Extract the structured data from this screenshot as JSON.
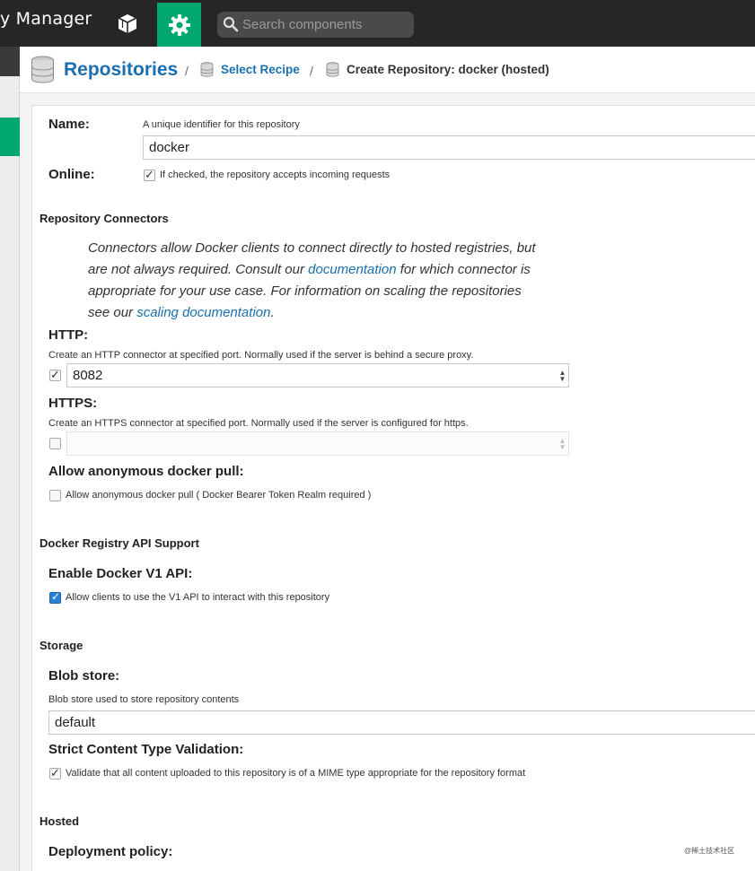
{
  "app": {
    "title": "y Manager"
  },
  "topbar": {
    "browse_icon": "cube-icon",
    "admin_icon": "gear-icon",
    "search": {
      "placeholder": "Search components",
      "value": ""
    }
  },
  "breadcrumb": {
    "root": "Repositories",
    "separator": "/",
    "recipe": "Select Recipe",
    "current": "Create Repository: docker (hosted)"
  },
  "form": {
    "name": {
      "label": "Name:",
      "help": "A unique identifier for this repository",
      "value": "docker"
    },
    "online": {
      "label": "Online:",
      "checkbox_label": "If checked, the repository accepts incoming requests",
      "checked": true
    },
    "connectors": {
      "section": "Repository Connectors",
      "info_1": "Connectors allow Docker clients to connect directly to hosted registries, but are not always required. Consult our ",
      "info_link_1": "documentation",
      "info_2": " for which connector is appropriate for your use case. For information on scaling the repositories see our ",
      "info_link_2": "scaling documentation",
      "info_3": ".",
      "http": {
        "label": "HTTP:",
        "help": "Create an HTTP connector at specified port. Normally used if the server is behind a secure proxy.",
        "checked": true,
        "value": "8082"
      },
      "https": {
        "label": "HTTPS:",
        "help": "Create an HTTPS connector at specified port. Normally used if the server is configured for https.",
        "checked": false,
        "value": ""
      },
      "anon": {
        "label": "Allow anonymous docker pull:",
        "checkbox_label": "Allow anonymous docker pull ( Docker Bearer Token Realm required )",
        "checked": false
      }
    },
    "api": {
      "section": "Docker Registry API Support",
      "v1": {
        "label": "Enable Docker V1 API:",
        "checkbox_label": "Allow clients to use the V1 API to interact with this repository",
        "checked": true
      }
    },
    "storage": {
      "section": "Storage",
      "blob": {
        "label": "Blob store:",
        "help": "Blob store used to store repository contents",
        "value": "default"
      },
      "strict": {
        "label": "Strict Content Type Validation:",
        "checkbox_label": "Validate that all content uploaded to this repository is of a MIME type appropriate for the repository format",
        "checked": true
      }
    },
    "hosted": {
      "section": "Hosted",
      "deployment": {
        "label": "Deployment policy:"
      }
    }
  },
  "watermark": "@稀土技术社区",
  "colors": {
    "accent_green": "#00a870",
    "link_blue": "#1a6fb0",
    "topbar": "#262626"
  }
}
